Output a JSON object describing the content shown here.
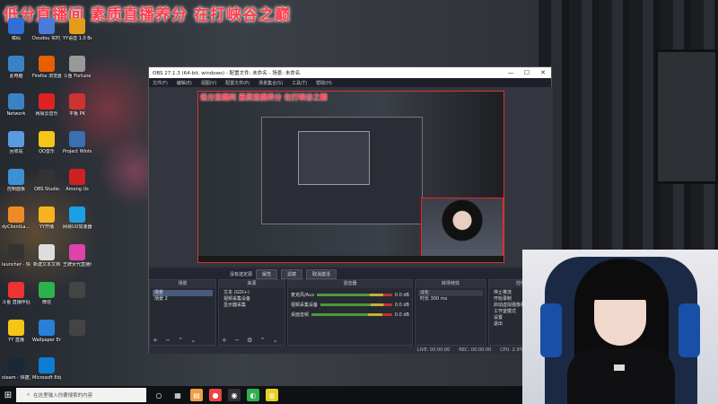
{
  "overlay": {
    "stream_title": "低分直播间  素质直播养分  在打峡谷之巅"
  },
  "desktop": {
    "icons": [
      {
        "label": "赋码",
        "icon": "app-icon",
        "color": "#2f6fd6"
      },
      {
        "label": "Doudou 实时互动",
        "icon": "chat-icon",
        "color": "#4a7bd8"
      },
      {
        "label": "YY语音 1.0 Beta",
        "icon": "yy-icon",
        "color": "#e59b1c"
      },
      {
        "label": "此电脑",
        "icon": "computer-icon",
        "color": "#3b82c4"
      },
      {
        "label": "Firefox 浏览器",
        "icon": "firefox-icon",
        "color": "#e66000"
      },
      {
        "label": "斗鱼 Fortune",
        "icon": "game-icon",
        "color": "#999"
      },
      {
        "label": "Network",
        "icon": "network-icon",
        "color": "#3b82c4"
      },
      {
        "label": "网易云音乐",
        "icon": "music-icon",
        "color": "#d22"
      },
      {
        "label": "平板 PK",
        "icon": "app-icon",
        "color": "#c33"
      },
      {
        "label": "回收站",
        "icon": "recycle-bin-icon",
        "color": "#5a9be0"
      },
      {
        "label": "QQ音乐",
        "icon": "qq-music-icon",
        "color": "#f5c518"
      },
      {
        "label": "Project Winter",
        "icon": "game-icon",
        "color": "#3a6fb0"
      },
      {
        "label": "控制面板",
        "icon": "control-panel-icon",
        "color": "#3f8fd5"
      },
      {
        "label": "OBS Studio",
        "icon": "obs-icon",
        "color": "#333"
      },
      {
        "label": "Among Us",
        "icon": "game-icon",
        "color": "#c22"
      },
      {
        "label": "dyClientLa... - 快捷方式",
        "icon": "app-icon",
        "color": "#f08a24"
      },
      {
        "label": "YY开播",
        "icon": "yy-icon",
        "color": "#f5b41f"
      },
      {
        "label": "网易UU加速器",
        "icon": "uu-icon",
        "color": "#1ca0e3"
      },
      {
        "label": "launcher - 快捷方式",
        "icon": "app-icon",
        "color": "#333"
      },
      {
        "label": "新建文本文档",
        "icon": "text-file-icon",
        "color": "#ddd"
      },
      {
        "label": "王牌女代直播伴侣",
        "icon": "app-icon",
        "color": "#d4a"
      },
      {
        "label": "斗鱼 直播伴侣",
        "icon": "app-icon",
        "color": "#e33"
      },
      {
        "label": "微信",
        "icon": "wechat-icon",
        "color": "#2bb24c"
      },
      {
        "label": "",
        "icon": "app-icon",
        "color": "#444"
      },
      {
        "label": "YY 直播",
        "icon": "yy-icon",
        "color": "#f5c518"
      },
      {
        "label": "Wallpaper Engine",
        "icon": "wallpaper-icon",
        "color": "#2a7fd8"
      },
      {
        "label": "",
        "icon": "app-icon",
        "color": "#444"
      },
      {
        "label": "steam - 快捷方式",
        "icon": "steam-icon",
        "color": "#1b2838"
      },
      {
        "label": "Microsoft Edge",
        "icon": "edge-icon",
        "color": "#0c7cd5"
      }
    ]
  },
  "obs": {
    "title": "OBS 27.1.3 (64-bit, windows) - 配置文件: 未命名 - 场景: 未命名",
    "win_min": "—",
    "win_max": "☐",
    "win_close": "✕",
    "menu": [
      "文件(F)",
      "编辑(E)",
      "视图(V)",
      "配置文件(P)",
      "场景集合(S)",
      "工具(T)",
      "帮助(H)"
    ],
    "inner_title": "低分直播间  素质直播养分  在打峡谷之巅",
    "controls": {
      "source_label": "没有选定源",
      "properties": "属性",
      "filters": "滤镜",
      "deactivate": "取消激活"
    },
    "docks": {
      "scenes": {
        "header": "场景",
        "items": [
          "场景",
          "场景 2"
        ]
      },
      "sources": {
        "header": "来源",
        "items": [
          "文本 (GDI+)",
          "视频采集设备",
          "显示器采集"
        ]
      },
      "mixer": {
        "header": "混音器",
        "channels": [
          {
            "name": "麦克风/Aux",
            "db": "0.0 dB"
          },
          {
            "name": "视频采集设备",
            "db": "0.0 dB"
          },
          {
            "name": "桌面音频",
            "db": "0.0 dB"
          }
        ]
      },
      "transitions": {
        "header": "转场特效",
        "type": "淡化",
        "duration_label": "时长",
        "duration": "300 ms"
      },
      "controls": {
        "header": "控件",
        "items": [
          "停止推流",
          "开始录制",
          "启动虚拟摄像机",
          "工作室模式",
          "设置",
          "退出"
        ]
      }
    },
    "status": {
      "live": "LIVE: 00:00:00",
      "rec": "REC: 00:00:00",
      "cpu": "CPU: 2.9%, 60.00 fps"
    }
  },
  "taskbar": {
    "search_placeholder": "在这里输入你要搜索的内容"
  }
}
